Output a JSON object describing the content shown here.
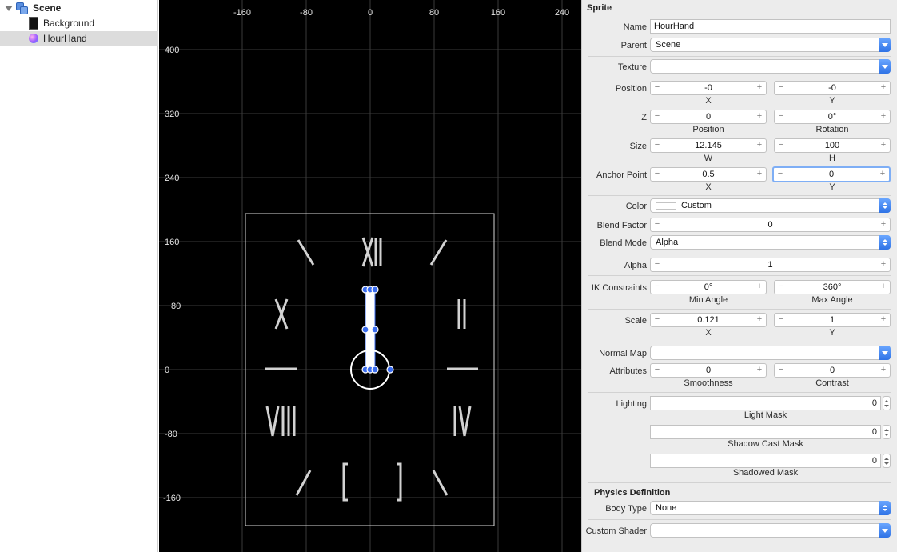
{
  "outline": {
    "items": [
      {
        "label": "Scene",
        "icon": "scene-icon",
        "selected": false
      },
      {
        "label": "Background",
        "icon": "image-thumbnail-icon",
        "selected": false
      },
      {
        "label": "HourHand",
        "icon": "sprite-icon",
        "selected": true
      }
    ]
  },
  "canvas": {
    "x_ticks": [
      "-160",
      "-80",
      "0",
      "80",
      "160",
      "240"
    ],
    "y_ticks": [
      "400",
      "320",
      "240",
      "160",
      "80",
      "0",
      "-80",
      "-160"
    ],
    "clock_numerals": [
      "XII",
      "II",
      "IV",
      "VIII",
      "X"
    ],
    "background_color": "#000000",
    "handle_color": "#3b6df0"
  },
  "inspector": {
    "section_title": "Sprite",
    "name_label": "Name",
    "name_value": "HourHand",
    "parent_label": "Parent",
    "parent_value": "Scene",
    "texture_label": "Texture",
    "texture_value": "",
    "position_label": "Position",
    "position_x": "-0",
    "position_y": "-0",
    "x_label": "X",
    "y_label": "Y",
    "z_label": "Z",
    "z_position": "0",
    "z_rotation": "0°",
    "position_sub": "Position",
    "rotation_sub": "Rotation",
    "size_label": "Size",
    "size_w": "12.145",
    "size_h": "100",
    "w_label": "W",
    "h_label": "H",
    "anchor_label": "Anchor Point",
    "anchor_x": "0.5",
    "anchor_y": "0",
    "color_label": "Color",
    "color_value": "Custom",
    "blend_factor_label": "Blend Factor",
    "blend_factor_value": "0",
    "blend_mode_label": "Blend Mode",
    "blend_mode_value": "Alpha",
    "alpha_label": "Alpha",
    "alpha_value": "1",
    "ik_label": "IK Constraints",
    "ik_min": "0°",
    "ik_max": "360°",
    "min_angle_label": "Min Angle",
    "max_angle_label": "Max Angle",
    "scale_label": "Scale",
    "scale_x": "0.121",
    "scale_y": "1",
    "normal_map_label": "Normal Map",
    "normal_map_value": "",
    "attributes_label": "Attributes",
    "smoothness_value": "0",
    "contrast_value": "0",
    "smoothness_label": "Smoothness",
    "contrast_label": "Contrast",
    "lighting_label": "Lighting",
    "light_mask_value": "0",
    "light_mask_label": "Light Mask",
    "shadow_cast_value": "0",
    "shadow_cast_label": "Shadow Cast Mask",
    "shadowed_value": "0",
    "shadowed_label": "Shadowed Mask",
    "physics_title": "Physics Definition",
    "body_type_label": "Body Type",
    "body_type_value": "None",
    "custom_shader_label": "Custom Shader",
    "custom_shader_value": ""
  }
}
